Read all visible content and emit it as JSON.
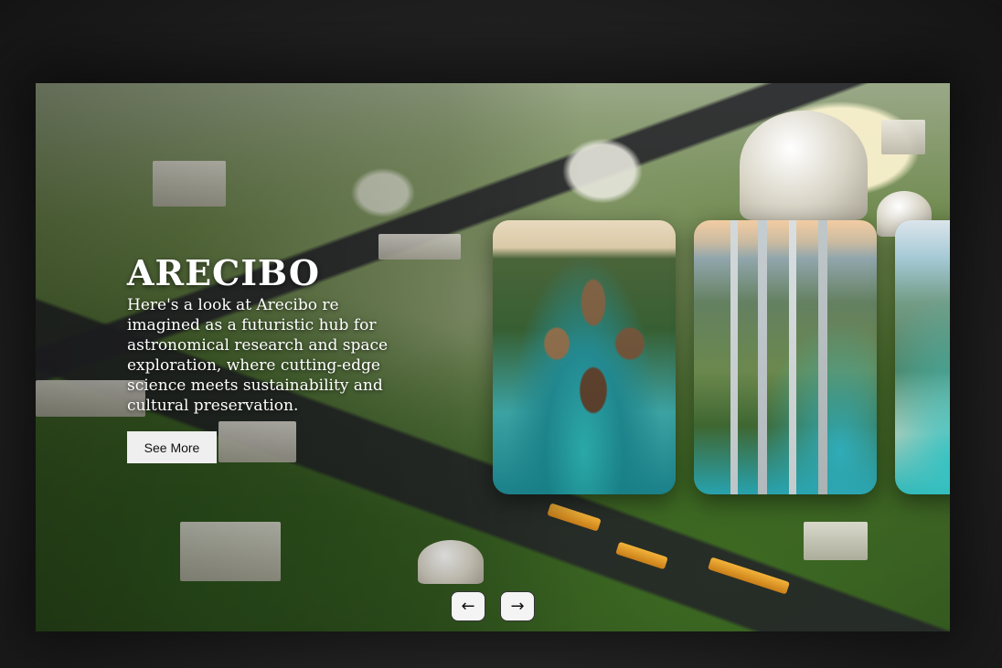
{
  "slider": {
    "active": {
      "title": "ARECIBO",
      "description": "Here's a look at Arecibo re imagined as a futuristic hub for astronomical research and space exploration, where cutting-edge science meets sustainability and cultural preservation.",
      "button_label": "See More"
    },
    "thumbnails": [
      {
        "name": "thumbnail-eco-village"
      },
      {
        "name": "thumbnail-green-city"
      },
      {
        "name": "thumbnail-smart-coast"
      }
    ],
    "nav": {
      "prev_icon": "←",
      "next_icon": "→"
    }
  }
}
